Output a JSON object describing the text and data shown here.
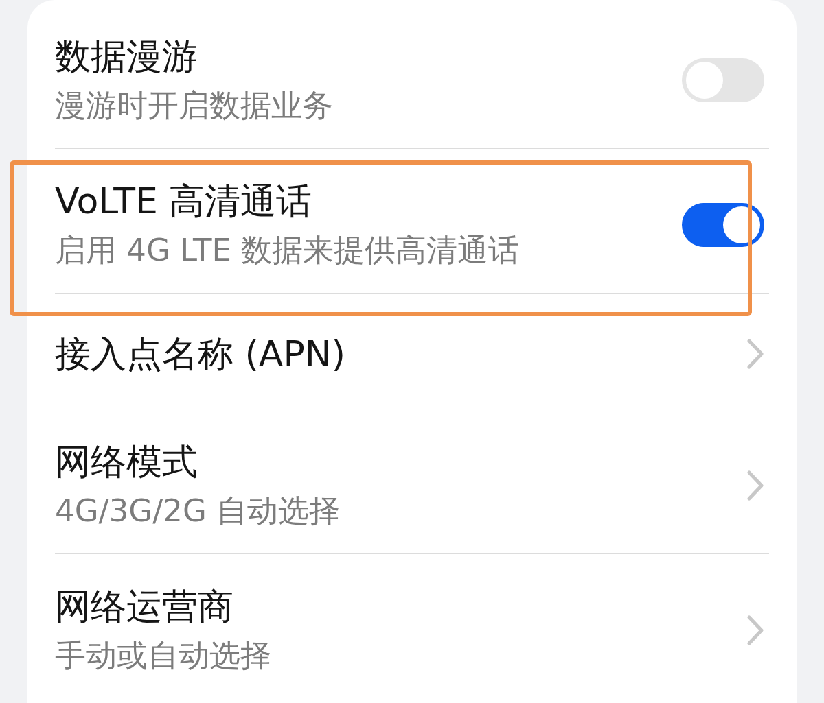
{
  "items": [
    {
      "kind": "switch",
      "title": "数据漫游",
      "subtitle": "漫游时开启数据业务",
      "on": false,
      "highlighted": false
    },
    {
      "kind": "switch",
      "title": "VoLTE 高清通话",
      "subtitle": "启用 4G LTE 数据来提供高清通话",
      "on": true,
      "highlighted": true
    },
    {
      "kind": "link",
      "title": "接入点名称 (APN)",
      "highlighted": false
    },
    {
      "kind": "link",
      "title": "网络模式",
      "subtitle": "4G/3G/2G 自动选择",
      "highlighted": false
    },
    {
      "kind": "link",
      "title": "网络运营商",
      "subtitle": "手动或自动选择",
      "highlighted": false
    }
  ]
}
